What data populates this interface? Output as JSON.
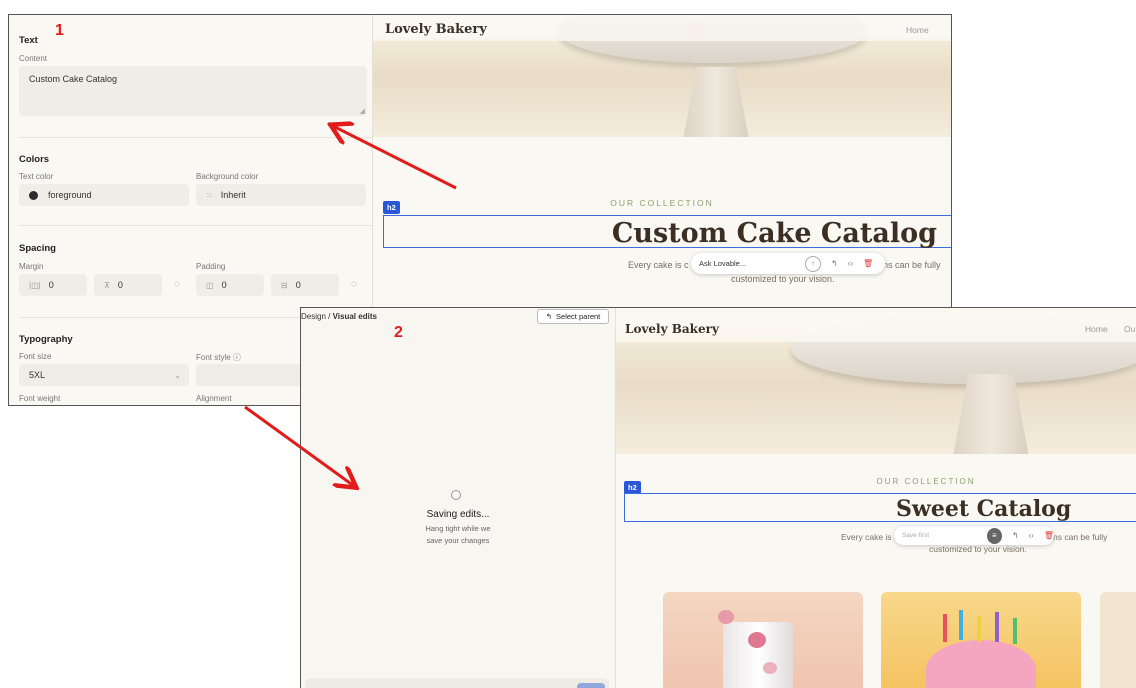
{
  "screen1": {
    "label": "1",
    "panel": {
      "text_section": "Text",
      "content_label": "Content",
      "content_value": "Custom Cake Catalog",
      "colors_section": "Colors",
      "text_color_label": "Text color",
      "text_color_value": "foreground",
      "bg_color_label": "Background color",
      "bg_color_value": "Inherit",
      "spacing_section": "Spacing",
      "margin_label": "Margin",
      "padding_label": "Padding",
      "margin_x": "0",
      "margin_y": "0",
      "padding_x": "0",
      "padding_y": "0",
      "typography_section": "Typography",
      "font_size_label": "Font size",
      "font_size_value": "5XL",
      "font_style_label": "Font style ⓘ",
      "font_weight_label": "Font weight",
      "alignment_label": "Alignment"
    },
    "site": {
      "brand": "Lovely Bakery",
      "nav": [
        "Home"
      ],
      "collection": "OUR COLLECTION",
      "tag": "h2",
      "heading": "Custom Cake Catalog",
      "sub_left": "Every cake is c",
      "sub_right": "ns can be fully",
      "sub_line2": "customized to your vision.",
      "ask_placeholder": "Ask Lovable..."
    }
  },
  "screen2": {
    "label": "2",
    "breadcrumb_root": "Design",
    "breadcrumb_sep": "/",
    "breadcrumb_current": "Visual edits",
    "select_parent": "Select parent",
    "saving_title": "Saving edits...",
    "saving_line1": "Hang tight while we",
    "saving_line2": "save your changes",
    "site": {
      "brand": "Lovely Bakery",
      "nav": [
        "Home",
        "Ou"
      ],
      "collection": "OUR COLLECTION",
      "tag": "h2",
      "heading": "Sweet Catalog",
      "sub_left": "Every cake is c",
      "sub_right": "ns can be fully",
      "sub_line2": "customized to your vision.",
      "toolbar_placeholder": "Save first"
    }
  },
  "colors": {
    "arrow": "#e21b1b",
    "selection": "#3a6ee0",
    "badge": "#2a57d8",
    "heading": "#3b2e22",
    "accent_green": "#8aa070"
  },
  "icons": [
    "arrow-up-icon",
    "select-parent-icon",
    "code-icon",
    "trash-icon",
    "spinner-icon",
    "margin-icon",
    "padding-icon"
  ]
}
